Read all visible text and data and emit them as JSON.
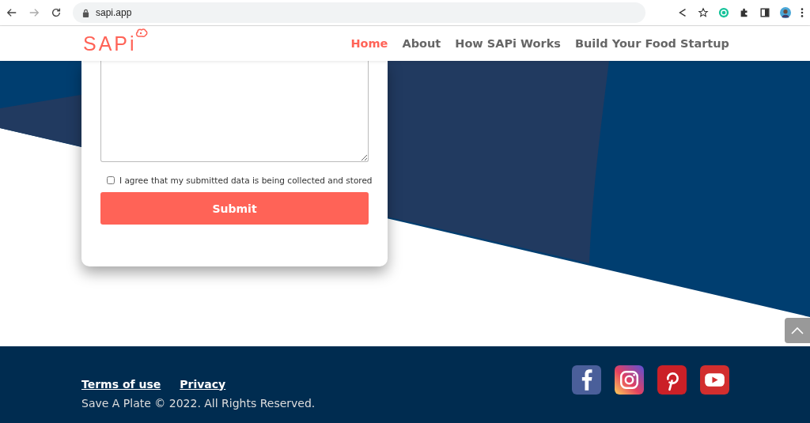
{
  "browser": {
    "url": "sapi.app"
  },
  "nav": {
    "logo": "SAPi",
    "items": [
      {
        "label": "Home",
        "selected": true
      },
      {
        "label": "About",
        "selected": false
      },
      {
        "label": "How SAPi Works",
        "selected": false
      },
      {
        "label": "Build Your Food Startup",
        "selected": false
      }
    ]
  },
  "form": {
    "consent": {
      "label": "I agree that my submitted data is being collected and stored",
      "checked": false
    },
    "submit": "Submit"
  },
  "footer": {
    "links": [
      "Terms of use",
      "Privacy"
    ],
    "copyright": "Save A Plate © 2022. All Rights Reserved.",
    "social": [
      {
        "kind": "facebook"
      },
      {
        "kind": "instagram"
      },
      {
        "kind": "pinterest"
      },
      {
        "kind": "youtube"
      }
    ]
  }
}
